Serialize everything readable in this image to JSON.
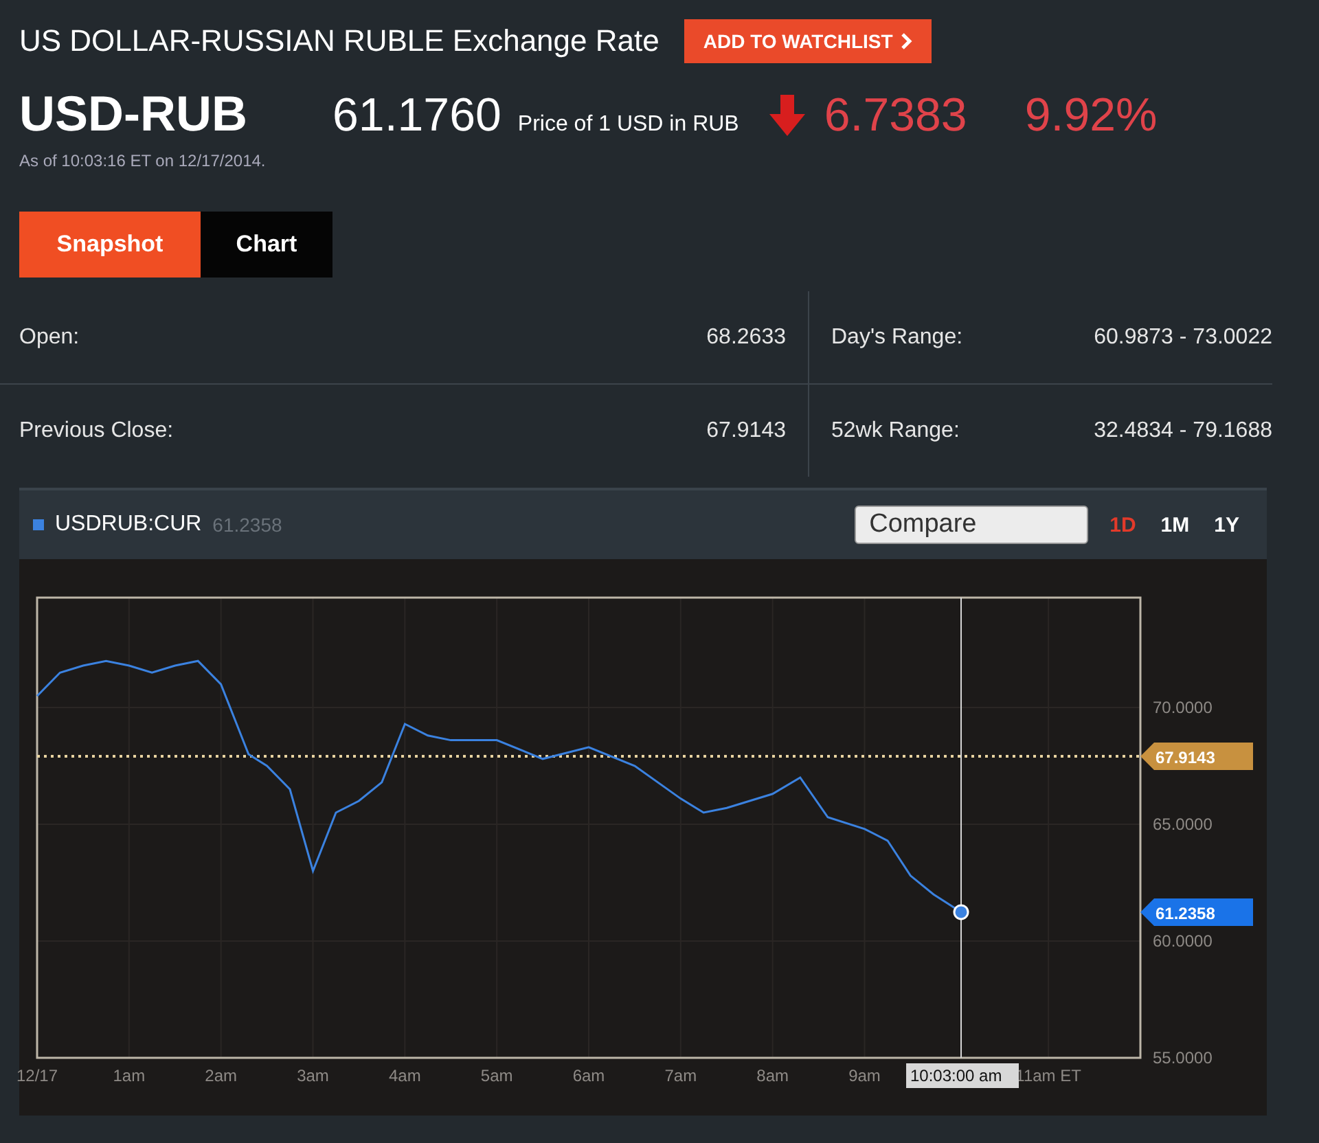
{
  "header": {
    "title": "US DOLLAR-RUSSIAN RUBLE Exchange Rate",
    "watchlist_button": "ADD TO WATCHLIST"
  },
  "quote": {
    "symbol": "USD-RUB",
    "price": "61.1760",
    "price_note": "Price of 1 USD in RUB",
    "falling": true,
    "change": "6.7383",
    "change_pct": "9.92%",
    "as_of": "As of 10:03:16 ET on 12/17/2014."
  },
  "tabs": [
    {
      "label": "Snapshot",
      "selected": true
    },
    {
      "label": "Chart",
      "selected": false
    }
  ],
  "stats": [
    {
      "label": "Open:",
      "value": "68.2633"
    },
    {
      "label": "Day's Range:",
      "value": "60.9873 - 73.0022"
    },
    {
      "label": "Previous Close:",
      "value": "67.9143"
    },
    {
      "label": "52wk Range:",
      "value": "32.4834 - 79.1688"
    }
  ],
  "chart_panel": {
    "legend": {
      "value": "61.2358"
    },
    "compare": {
      "placeholder": "Compare"
    },
    "ranges": [
      {
        "label": "1D",
        "selected": true
      },
      {
        "label": "1M",
        "selected": false
      },
      {
        "label": "1Y",
        "selected": false
      }
    ],
    "chart_data": {
      "type": "line",
      "x": [
        0,
        0.25,
        0.5,
        0.75,
        1,
        1.25,
        1.5,
        1.75,
        2,
        2.2,
        2.3,
        2.5,
        2.75,
        3,
        3.25,
        3.5,
        3.75,
        4,
        4.25,
        4.5,
        5,
        5.5,
        6,
        6.5,
        7,
        7.25,
        7.5,
        8,
        8.3,
        8.6,
        9,
        9.25,
        9.5,
        9.75,
        10.05
      ],
      "series": [
        {
          "name": "USDRUB:CUR",
          "color": "#3b82e0",
          "values": [
            70.5,
            71.5,
            71.8,
            72,
            71.8,
            71.5,
            71.8,
            72,
            71,
            69,
            68,
            67.5,
            66.5,
            63,
            65.5,
            66,
            66.8,
            69.3,
            68.8,
            68.6,
            68.6,
            67.8,
            68.3,
            67.5,
            66.1,
            65.5,
            65.7,
            66.3,
            67,
            65.3,
            64.8,
            64.3,
            62.8,
            62,
            61.24
          ]
        }
      ],
      "xlim": [
        0,
        12
      ],
      "ylim": [
        55,
        74.71
      ],
      "xticks": [
        {
          "value": 0,
          "label": "12/17"
        },
        {
          "value": 1,
          "label": "1am"
        },
        {
          "value": 2,
          "label": "2am"
        },
        {
          "value": 3,
          "label": "3am"
        },
        {
          "value": 4,
          "label": "4am"
        },
        {
          "value": 5,
          "label": "5am"
        },
        {
          "value": 6,
          "label": "6am"
        },
        {
          "value": 7,
          "label": "7am"
        },
        {
          "value": 8,
          "label": "8am"
        },
        {
          "value": 9,
          "label": "9am"
        },
        {
          "value": 11,
          "label": "11am ET"
        }
      ],
      "yticks": [
        {
          "value": 55,
          "label": "55.0000"
        },
        {
          "value": 60,
          "label": "60.0000"
        },
        {
          "value": 65,
          "label": "65.0000"
        },
        {
          "value": 70,
          "label": "70.0000"
        }
      ],
      "grid": true,
      "ref_lines": [
        {
          "axis": "y",
          "value": 67.9143,
          "label": "67.9143"
        },
        {
          "axis": "x",
          "value": 10.05,
          "label": "10:03:00 am"
        }
      ],
      "annotations": [
        "61.2358"
      ]
    }
  }
}
